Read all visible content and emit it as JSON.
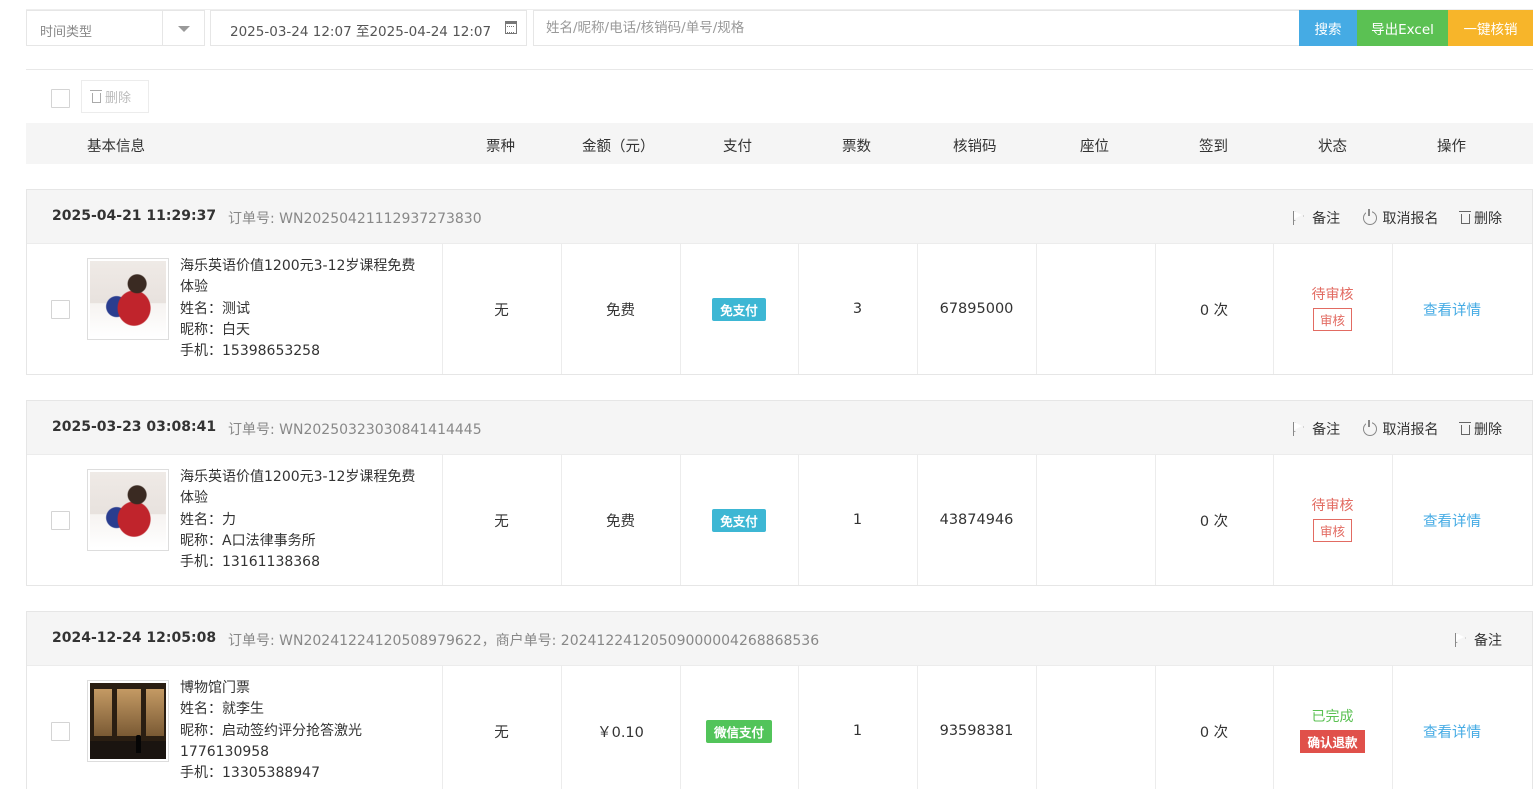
{
  "filter": {
    "time_type": "时间类型",
    "date_range": "2025-03-24 12:07 至2025-04-24 12:07",
    "search_placeholder": "姓名/昵称/电话/核销码/单号/规格",
    "search_label": "搜索",
    "export_label": "导出Excel",
    "verify_label": "一键核销"
  },
  "toolbar": {
    "delete_label": "删除"
  },
  "columns": {
    "info": "基本信息",
    "ticket_type": "票种",
    "amount": "金额（元）",
    "payment": "支付",
    "count": "票数",
    "code": "核销码",
    "seat": "座位",
    "signin": "签到",
    "status": "状态",
    "action": "操作"
  },
  "orders": [
    {
      "time": "2025-04-21 11:29:37",
      "order_no": "订单号: WN20250421112937273830",
      "actions": {
        "remark": "备注",
        "cancel": "取消报名",
        "delete": "删除"
      },
      "title_line1": "海乐英语价值1200元3-12岁课程免费",
      "title_line2": "体验",
      "name": "姓名：测试",
      "nickname": "昵称：白天",
      "phone": "手机：15398653258",
      "ticket_type": "无",
      "amount": "免费",
      "payment": "免支付",
      "count": "3",
      "code": "67895000",
      "seat": "",
      "signin": "0 次",
      "status": "待审核",
      "status_button": "审核",
      "detail": "查看详情"
    },
    {
      "time": "2025-03-23 03:08:41",
      "order_no": "订单号: WN20250323030841414445",
      "actions": {
        "remark": "备注",
        "cancel": "取消报名",
        "delete": "删除"
      },
      "title_line1": "海乐英语价值1200元3-12岁课程免费",
      "title_line2": "体验",
      "name": "姓名：力",
      "nickname": "昵称：A口法律事务所",
      "phone": "手机：13161138368",
      "ticket_type": "无",
      "amount": "免费",
      "payment": "免支付",
      "count": "1",
      "code": "43874946",
      "seat": "",
      "signin": "0 次",
      "status": "待审核",
      "status_button": "审核",
      "detail": "查看详情"
    },
    {
      "time": "2024-12-24 12:05:08",
      "order_no": "订单号: WN20241224120508979622，商户单号: 20241224120509000004268868536",
      "actions": {
        "remark": "备注"
      },
      "title_line1": "博物馆门票",
      "name": "姓名：就李生",
      "nickname_line1": "昵称：启动签约评分抢答激光",
      "nickname_line2": "1776130958",
      "phone": "手机：13305388947",
      "ticket_type": "无",
      "amount": "￥0.10",
      "payment": "微信支付",
      "count": "1",
      "code": "93598381",
      "seat": "",
      "signin": "0 次",
      "status": "已完成",
      "status_button": "确认退款",
      "detail": "查看详情"
    }
  ],
  "colors": {
    "search": "#45abe4",
    "export": "#5bc153",
    "verify": "#f7b52a",
    "pending": "#e26b62",
    "done": "#5bc153",
    "free_pay_badge": "#3db7d4",
    "wechat_pay_badge": "#52c45a",
    "refund_button": "#e0504a",
    "link": "#45abe4"
  },
  "icons": {
    "dropdown": "chevron-down-icon",
    "calendar": "calendar-icon",
    "remark": "flag-icon",
    "cancel": "power-icon",
    "delete": "trash-icon"
  }
}
